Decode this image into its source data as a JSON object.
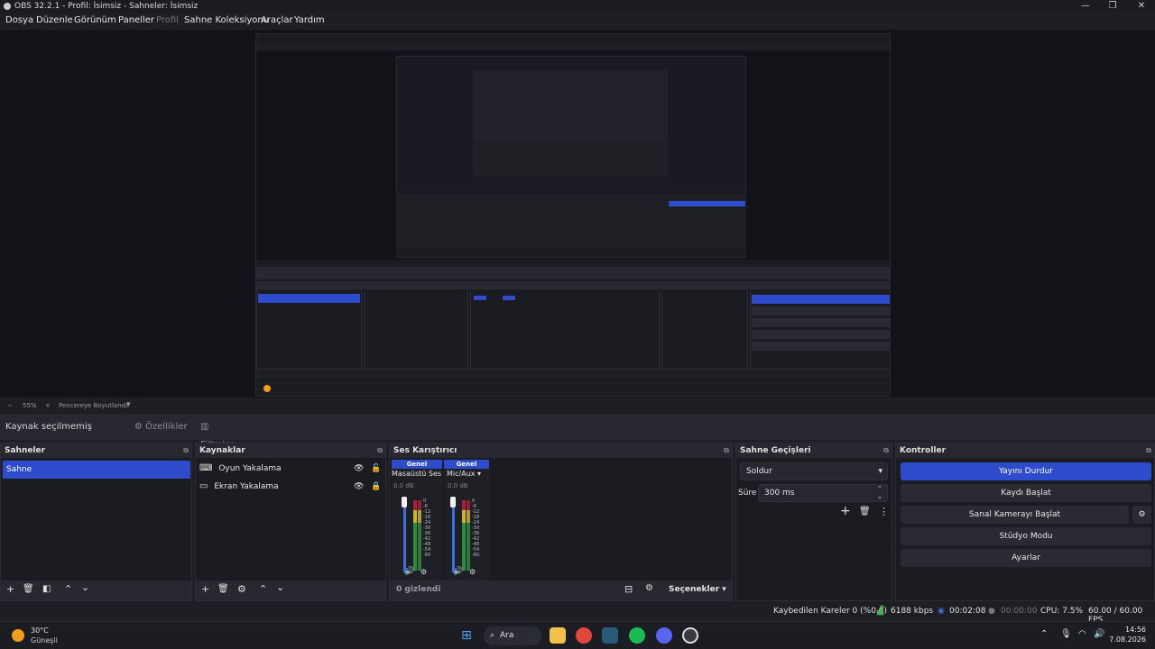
{
  "window": {
    "title": "OBS 32.2.1 - Profil: İsimsiz - Sahneler: İsimsiz",
    "minimize": "—",
    "maximize": "❐",
    "close": "✕"
  },
  "menu": [
    "Dosya",
    "Düzenle",
    "Görünüm",
    "Paneller",
    "Profil",
    "Sahne Koleksiyonu",
    "Araçlar",
    "Yardım"
  ],
  "zoom": {
    "minus": "−",
    "value": "55%",
    "plus": "+",
    "fit": "Pencereye Boyutlandır"
  },
  "source_bar": {
    "no_selection": "Kaynak seçilmemiş",
    "properties": "Özellikler",
    "filters": "Filtreler"
  },
  "scenes": {
    "title": "Sahneler",
    "items": [
      "Sahne"
    ]
  },
  "sources": {
    "title": "Kaynaklar",
    "items": [
      {
        "name": "Oyun Yakalama",
        "icon": "gamepad-icon"
      },
      {
        "name": "Ekran Yakalama",
        "icon": "monitor-icon"
      }
    ]
  },
  "mixer": {
    "title": "Ses Karıştırıcı",
    "channels": [
      {
        "header": "Genel",
        "name": "Masaüstü Ses",
        "db": "0.0 dB",
        "level": 1.0
      },
      {
        "header": "Genel",
        "name": "Mic/Aux",
        "db": "0.0 dB",
        "level": 1.0
      }
    ],
    "ticks": [
      "0",
      "-6",
      "-12",
      "-18",
      "-24",
      "-30",
      "-36",
      "-42",
      "-48",
      "-54",
      "-60"
    ],
    "hidden": "0 gizlendi",
    "options": "Seçenekler"
  },
  "transitions": {
    "title": "Sahne Geçişleri",
    "selected": "Soldur",
    "duration_label": "Süre",
    "duration_value": "300 ms"
  },
  "controls": {
    "title": "Kontroller",
    "stop_stream": "Yayını Durdur",
    "start_recording": "Kaydı Başlat",
    "start_virtualcam": "Sanal Kamerayı Başlat",
    "studio_mode": "Stüdyo Modu",
    "settings": "Ayarlar"
  },
  "status": {
    "dropped": "Kaybedilen Kareler 0 (%0.0)",
    "bitrate": "6188 kbps",
    "stream_time": "00:02:08",
    "rec_time": "00:00:00",
    "cpu": "CPU: 7.5%",
    "fps": "60.00 / 60.00 FPS"
  },
  "taskbar": {
    "weather_temp": "30°C",
    "weather_desc": "Güneşli",
    "search": "Ara",
    "time": "14:56",
    "date": "7.08.2026"
  },
  "colors": {
    "accent": "#2e4bcc",
    "background": "#1e1f24",
    "panel": "#1b1c21"
  }
}
